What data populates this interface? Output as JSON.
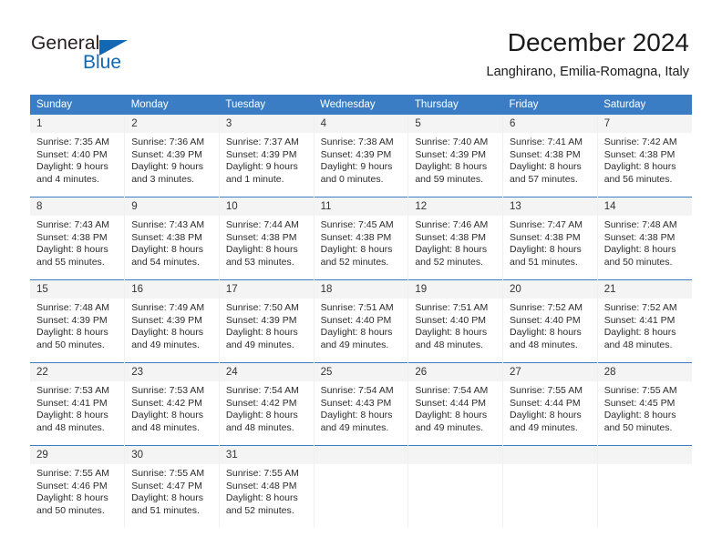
{
  "brand": {
    "name_dark": "General",
    "name_blue": "Blue",
    "accent_color": "#1268b3"
  },
  "header": {
    "title": "December 2024",
    "subtitle": "Langhirano, Emilia-Romagna, Italy",
    "header_bg": "#3a7dc4",
    "daynum_bg": "#f4f4f4"
  },
  "weekdays": [
    "Sunday",
    "Monday",
    "Tuesday",
    "Wednesday",
    "Thursday",
    "Friday",
    "Saturday"
  ],
  "weeks": [
    [
      {
        "day": "1",
        "sunrise": "Sunrise: 7:35 AM",
        "sunset": "Sunset: 4:40 PM",
        "daylight1": "Daylight: 9 hours",
        "daylight2": "and 4 minutes."
      },
      {
        "day": "2",
        "sunrise": "Sunrise: 7:36 AM",
        "sunset": "Sunset: 4:39 PM",
        "daylight1": "Daylight: 9 hours",
        "daylight2": "and 3 minutes."
      },
      {
        "day": "3",
        "sunrise": "Sunrise: 7:37 AM",
        "sunset": "Sunset: 4:39 PM",
        "daylight1": "Daylight: 9 hours",
        "daylight2": "and 1 minute."
      },
      {
        "day": "4",
        "sunrise": "Sunrise: 7:38 AM",
        "sunset": "Sunset: 4:39 PM",
        "daylight1": "Daylight: 9 hours",
        "daylight2": "and 0 minutes."
      },
      {
        "day": "5",
        "sunrise": "Sunrise: 7:40 AM",
        "sunset": "Sunset: 4:39 PM",
        "daylight1": "Daylight: 8 hours",
        "daylight2": "and 59 minutes."
      },
      {
        "day": "6",
        "sunrise": "Sunrise: 7:41 AM",
        "sunset": "Sunset: 4:38 PM",
        "daylight1": "Daylight: 8 hours",
        "daylight2": "and 57 minutes."
      },
      {
        "day": "7",
        "sunrise": "Sunrise: 7:42 AM",
        "sunset": "Sunset: 4:38 PM",
        "daylight1": "Daylight: 8 hours",
        "daylight2": "and 56 minutes."
      }
    ],
    [
      {
        "day": "8",
        "sunrise": "Sunrise: 7:43 AM",
        "sunset": "Sunset: 4:38 PM",
        "daylight1": "Daylight: 8 hours",
        "daylight2": "and 55 minutes."
      },
      {
        "day": "9",
        "sunrise": "Sunrise: 7:43 AM",
        "sunset": "Sunset: 4:38 PM",
        "daylight1": "Daylight: 8 hours",
        "daylight2": "and 54 minutes."
      },
      {
        "day": "10",
        "sunrise": "Sunrise: 7:44 AM",
        "sunset": "Sunset: 4:38 PM",
        "daylight1": "Daylight: 8 hours",
        "daylight2": "and 53 minutes."
      },
      {
        "day": "11",
        "sunrise": "Sunrise: 7:45 AM",
        "sunset": "Sunset: 4:38 PM",
        "daylight1": "Daylight: 8 hours",
        "daylight2": "and 52 minutes."
      },
      {
        "day": "12",
        "sunrise": "Sunrise: 7:46 AM",
        "sunset": "Sunset: 4:38 PM",
        "daylight1": "Daylight: 8 hours",
        "daylight2": "and 52 minutes."
      },
      {
        "day": "13",
        "sunrise": "Sunrise: 7:47 AM",
        "sunset": "Sunset: 4:38 PM",
        "daylight1": "Daylight: 8 hours",
        "daylight2": "and 51 minutes."
      },
      {
        "day": "14",
        "sunrise": "Sunrise: 7:48 AM",
        "sunset": "Sunset: 4:38 PM",
        "daylight1": "Daylight: 8 hours",
        "daylight2": "and 50 minutes."
      }
    ],
    [
      {
        "day": "15",
        "sunrise": "Sunrise: 7:48 AM",
        "sunset": "Sunset: 4:39 PM",
        "daylight1": "Daylight: 8 hours",
        "daylight2": "and 50 minutes."
      },
      {
        "day": "16",
        "sunrise": "Sunrise: 7:49 AM",
        "sunset": "Sunset: 4:39 PM",
        "daylight1": "Daylight: 8 hours",
        "daylight2": "and 49 minutes."
      },
      {
        "day": "17",
        "sunrise": "Sunrise: 7:50 AM",
        "sunset": "Sunset: 4:39 PM",
        "daylight1": "Daylight: 8 hours",
        "daylight2": "and 49 minutes."
      },
      {
        "day": "18",
        "sunrise": "Sunrise: 7:51 AM",
        "sunset": "Sunset: 4:40 PM",
        "daylight1": "Daylight: 8 hours",
        "daylight2": "and 49 minutes."
      },
      {
        "day": "19",
        "sunrise": "Sunrise: 7:51 AM",
        "sunset": "Sunset: 4:40 PM",
        "daylight1": "Daylight: 8 hours",
        "daylight2": "and 48 minutes."
      },
      {
        "day": "20",
        "sunrise": "Sunrise: 7:52 AM",
        "sunset": "Sunset: 4:40 PM",
        "daylight1": "Daylight: 8 hours",
        "daylight2": "and 48 minutes."
      },
      {
        "day": "21",
        "sunrise": "Sunrise: 7:52 AM",
        "sunset": "Sunset: 4:41 PM",
        "daylight1": "Daylight: 8 hours",
        "daylight2": "and 48 minutes."
      }
    ],
    [
      {
        "day": "22",
        "sunrise": "Sunrise: 7:53 AM",
        "sunset": "Sunset: 4:41 PM",
        "daylight1": "Daylight: 8 hours",
        "daylight2": "and 48 minutes."
      },
      {
        "day": "23",
        "sunrise": "Sunrise: 7:53 AM",
        "sunset": "Sunset: 4:42 PM",
        "daylight1": "Daylight: 8 hours",
        "daylight2": "and 48 minutes."
      },
      {
        "day": "24",
        "sunrise": "Sunrise: 7:54 AM",
        "sunset": "Sunset: 4:42 PM",
        "daylight1": "Daylight: 8 hours",
        "daylight2": "and 48 minutes."
      },
      {
        "day": "25",
        "sunrise": "Sunrise: 7:54 AM",
        "sunset": "Sunset: 4:43 PM",
        "daylight1": "Daylight: 8 hours",
        "daylight2": "and 49 minutes."
      },
      {
        "day": "26",
        "sunrise": "Sunrise: 7:54 AM",
        "sunset": "Sunset: 4:44 PM",
        "daylight1": "Daylight: 8 hours",
        "daylight2": "and 49 minutes."
      },
      {
        "day": "27",
        "sunrise": "Sunrise: 7:55 AM",
        "sunset": "Sunset: 4:44 PM",
        "daylight1": "Daylight: 8 hours",
        "daylight2": "and 49 minutes."
      },
      {
        "day": "28",
        "sunrise": "Sunrise: 7:55 AM",
        "sunset": "Sunset: 4:45 PM",
        "daylight1": "Daylight: 8 hours",
        "daylight2": "and 50 minutes."
      }
    ],
    [
      {
        "day": "29",
        "sunrise": "Sunrise: 7:55 AM",
        "sunset": "Sunset: 4:46 PM",
        "daylight1": "Daylight: 8 hours",
        "daylight2": "and 50 minutes."
      },
      {
        "day": "30",
        "sunrise": "Sunrise: 7:55 AM",
        "sunset": "Sunset: 4:47 PM",
        "daylight1": "Daylight: 8 hours",
        "daylight2": "and 51 minutes."
      },
      {
        "day": "31",
        "sunrise": "Sunrise: 7:55 AM",
        "sunset": "Sunset: 4:48 PM",
        "daylight1": "Daylight: 8 hours",
        "daylight2": "and 52 minutes."
      },
      null,
      null,
      null,
      null
    ]
  ]
}
